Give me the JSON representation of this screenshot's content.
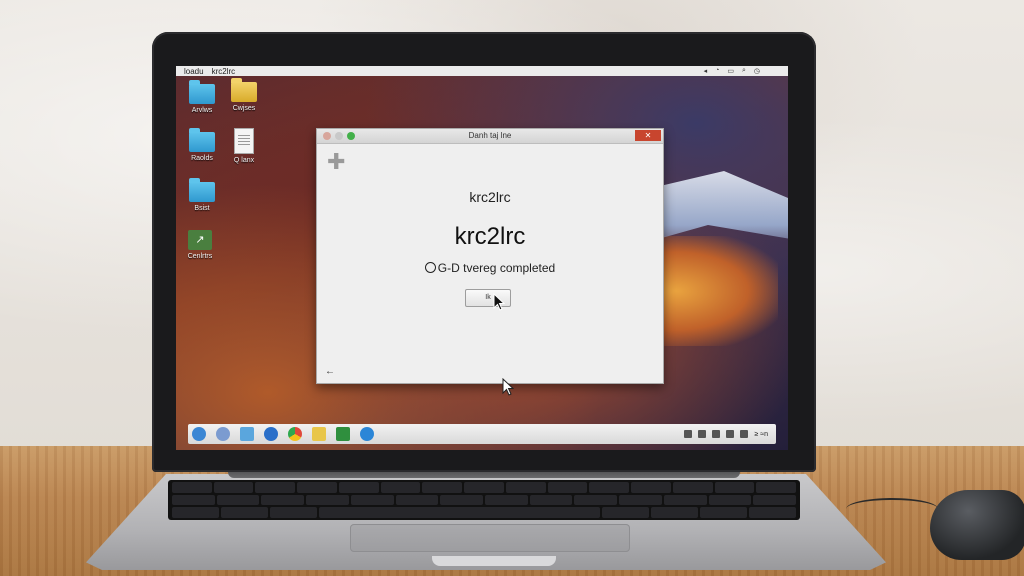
{
  "menubar": {
    "app_name": "krc2lrc",
    "menu_left": "loadu",
    "status_icons": [
      "volume-icon",
      "wifi-icon",
      "battery-icon",
      "search-icon",
      "clock-icon"
    ]
  },
  "desktop": {
    "icons": [
      {
        "label": "Arvlws",
        "type": "folder-blue"
      },
      {
        "label": "Cwjses",
        "type": "folder-yellow"
      },
      {
        "label": "Raolds",
        "type": "folder-blue"
      },
      {
        "label": "Q lanx",
        "type": "document"
      },
      {
        "label": "Bsist",
        "type": "folder-blue"
      },
      {
        "label": "Cenlrtrs",
        "type": "app"
      }
    ]
  },
  "dialog": {
    "window_title": "Danh taj lne",
    "header": "krc2lrc",
    "title": "krc2lrc",
    "status": "G-D tvereg completed",
    "ok_button": "Ik",
    "back_icon": "back-arrow-icon",
    "close_label": "✕"
  },
  "taskbar": {
    "apps": [
      {
        "name": "start-icon",
        "color": "#3a86d4"
      },
      {
        "name": "search-icon",
        "color": "#7b9bd0"
      },
      {
        "name": "explorer-icon",
        "color": "#5aa6dd"
      },
      {
        "name": "browser-ie-icon",
        "color": "#2a6fc9"
      },
      {
        "name": "chrome-icon",
        "color": "#e0483a"
      },
      {
        "name": "folder-icon",
        "color": "#e8c64a"
      },
      {
        "name": "app-green-icon",
        "color": "#2f8f3e"
      },
      {
        "name": "edge-icon",
        "color": "#2b86d7"
      }
    ],
    "clock": "≥ ≈n"
  }
}
